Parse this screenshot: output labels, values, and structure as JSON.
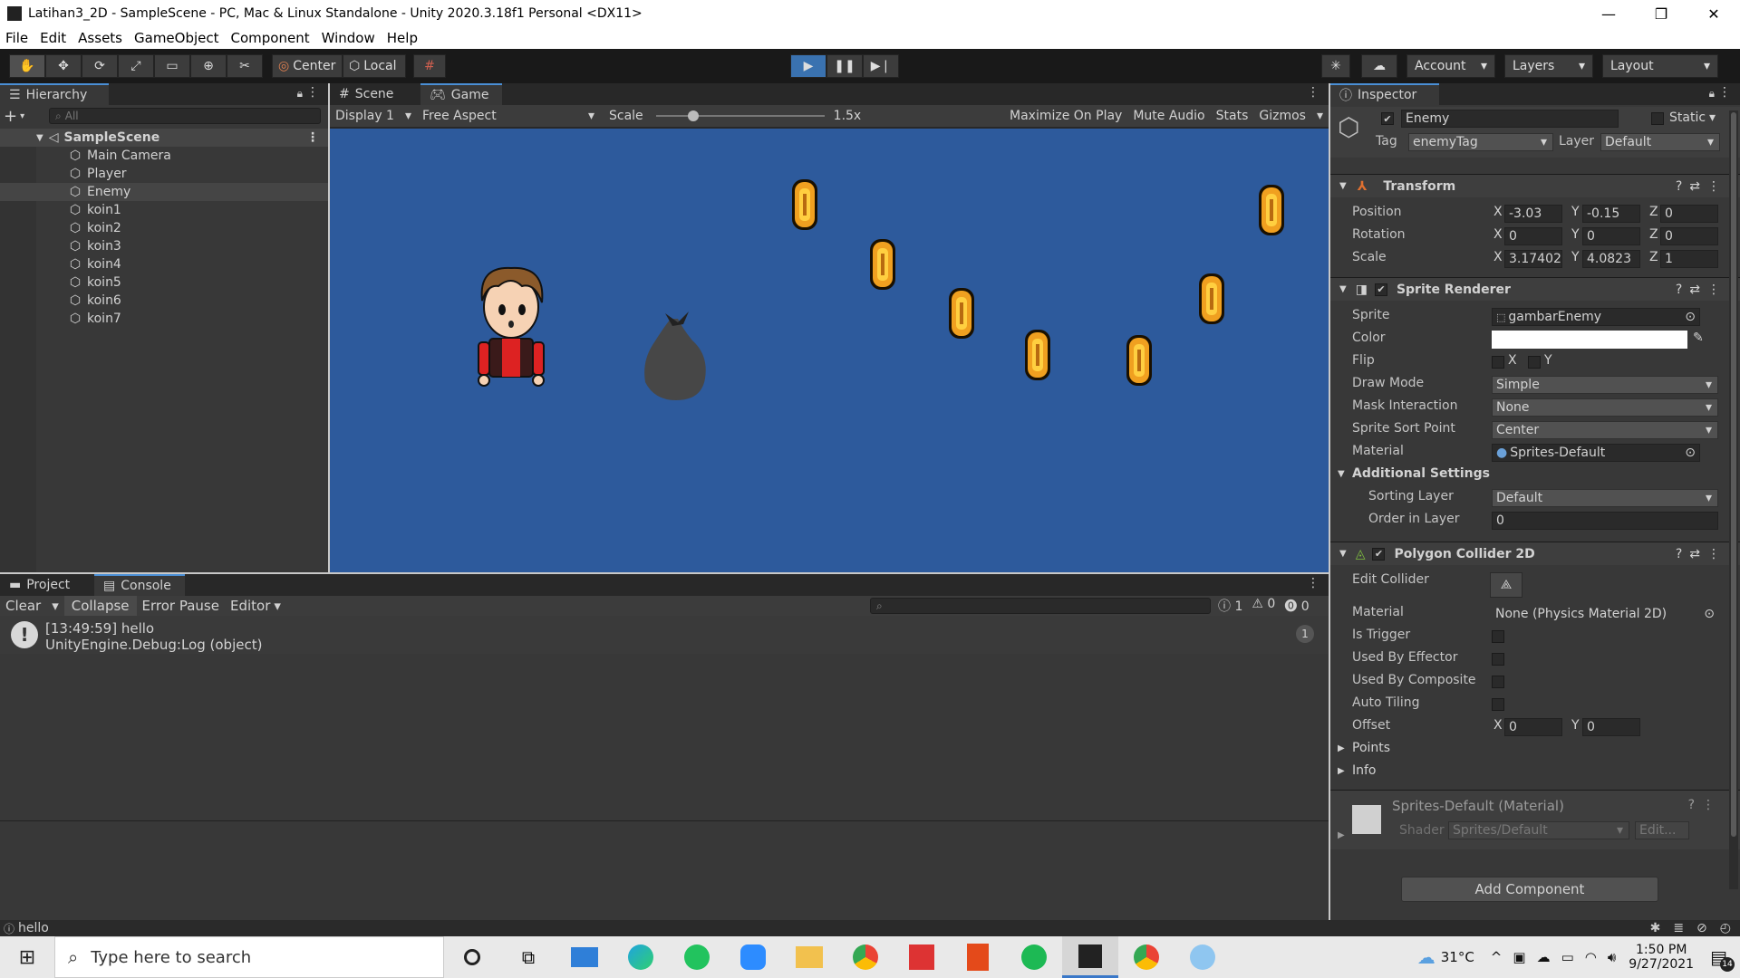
{
  "window": {
    "title": "Latihan3_2D - SampleScene - PC, Mac & Linux Standalone - Unity 2020.3.18f1 Personal <DX11>",
    "minimize": "—",
    "restore": "❐",
    "close": "✕"
  },
  "menu": [
    "File",
    "Edit",
    "Assets",
    "GameObject",
    "Component",
    "Window",
    "Help"
  ],
  "toolbar": {
    "center": "Center",
    "local": "Local",
    "account": "Account",
    "layers": "Layers",
    "layout": "Layout"
  },
  "hierarchy": {
    "title": "Hierarchy",
    "search_placeholder": "All",
    "scene": "SampleScene",
    "items": [
      "Main Camera",
      "Player",
      "Enemy",
      "koin1",
      "koin2",
      "koin3",
      "koin4",
      "koin5",
      "koin6",
      "koin7"
    ],
    "selected": "Enemy"
  },
  "game": {
    "tab_scene": "Scene",
    "tab_game": "Game",
    "display": "Display 1",
    "aspect": "Free Aspect",
    "scale_label": "Scale",
    "scale_value": "1.5x",
    "scale_fraction": 0.22,
    "maximize": "Maximize On Play",
    "mute": "Mute Audio",
    "stats": "Stats",
    "gizmos": "Gizmos",
    "bg_color": "#2d5a9c"
  },
  "console": {
    "tab_project": "Project",
    "tab_console": "Console",
    "clear": "Clear",
    "collapse": "Collapse",
    "error_pause": "Error Pause",
    "editor": "Editor",
    "count_log": "1",
    "count_warn": "0",
    "count_err": "0",
    "entry_line1": "[13:49:59] hello",
    "entry_line2": "UnityEngine.Debug:Log (object)",
    "entry_count": "1"
  },
  "statusbar": {
    "message": "hello"
  },
  "inspector": {
    "title": "Inspector",
    "name": "Enemy",
    "static": "Static",
    "tag_label": "Tag",
    "tag": "enemyTag",
    "layer_label": "Layer",
    "layer": "Default",
    "transform": {
      "title": "Transform",
      "position_label": "Position",
      "rotation_label": "Rotation",
      "scale_label": "Scale",
      "position": {
        "x": "-3.03",
        "y": "-0.15",
        "z": "0"
      },
      "rotation": {
        "x": "0",
        "y": "0",
        "z": "0"
      },
      "scale": {
        "x": "3.17402",
        "y": "4.0823",
        "z": "1"
      }
    },
    "sprite_renderer": {
      "title": "Sprite Renderer",
      "sprite_label": "Sprite",
      "sprite": "gambarEnemy",
      "color_label": "Color",
      "flip_label": "Flip",
      "flip_x": "X",
      "flip_y": "Y",
      "draw_mode_label": "Draw Mode",
      "draw_mode": "Simple",
      "mask_label": "Mask Interaction",
      "mask": "None",
      "sort_point_label": "Sprite Sort Point",
      "sort_point": "Center",
      "material_label": "Material",
      "material": "Sprites-Default",
      "additional": "Additional Settings",
      "sorting_layer_label": "Sorting Layer",
      "sorting_layer": "Default",
      "order_label": "Order in Layer",
      "order": "0"
    },
    "polygon": {
      "title": "Polygon Collider 2D",
      "edit_label": "Edit Collider",
      "material_label": "Material",
      "material": "None (Physics Material 2D)",
      "trigger_label": "Is Trigger",
      "effector_label": "Used By Effector",
      "composite_label": "Used By Composite",
      "tiling_label": "Auto Tiling",
      "offset_label": "Offset",
      "offset_x": "0",
      "offset_y": "0",
      "points": "Points",
      "info": "Info"
    },
    "material_block": {
      "title": "Sprites-Default (Material)",
      "shader_label": "Shader",
      "shader": "Sprites/Default",
      "edit": "Edit..."
    },
    "add_component": "Add Component"
  },
  "taskbar": {
    "search": "Type here to search",
    "weather": "31°C",
    "time": "1:50 PM",
    "date": "9/27/2021",
    "notif": "14"
  }
}
